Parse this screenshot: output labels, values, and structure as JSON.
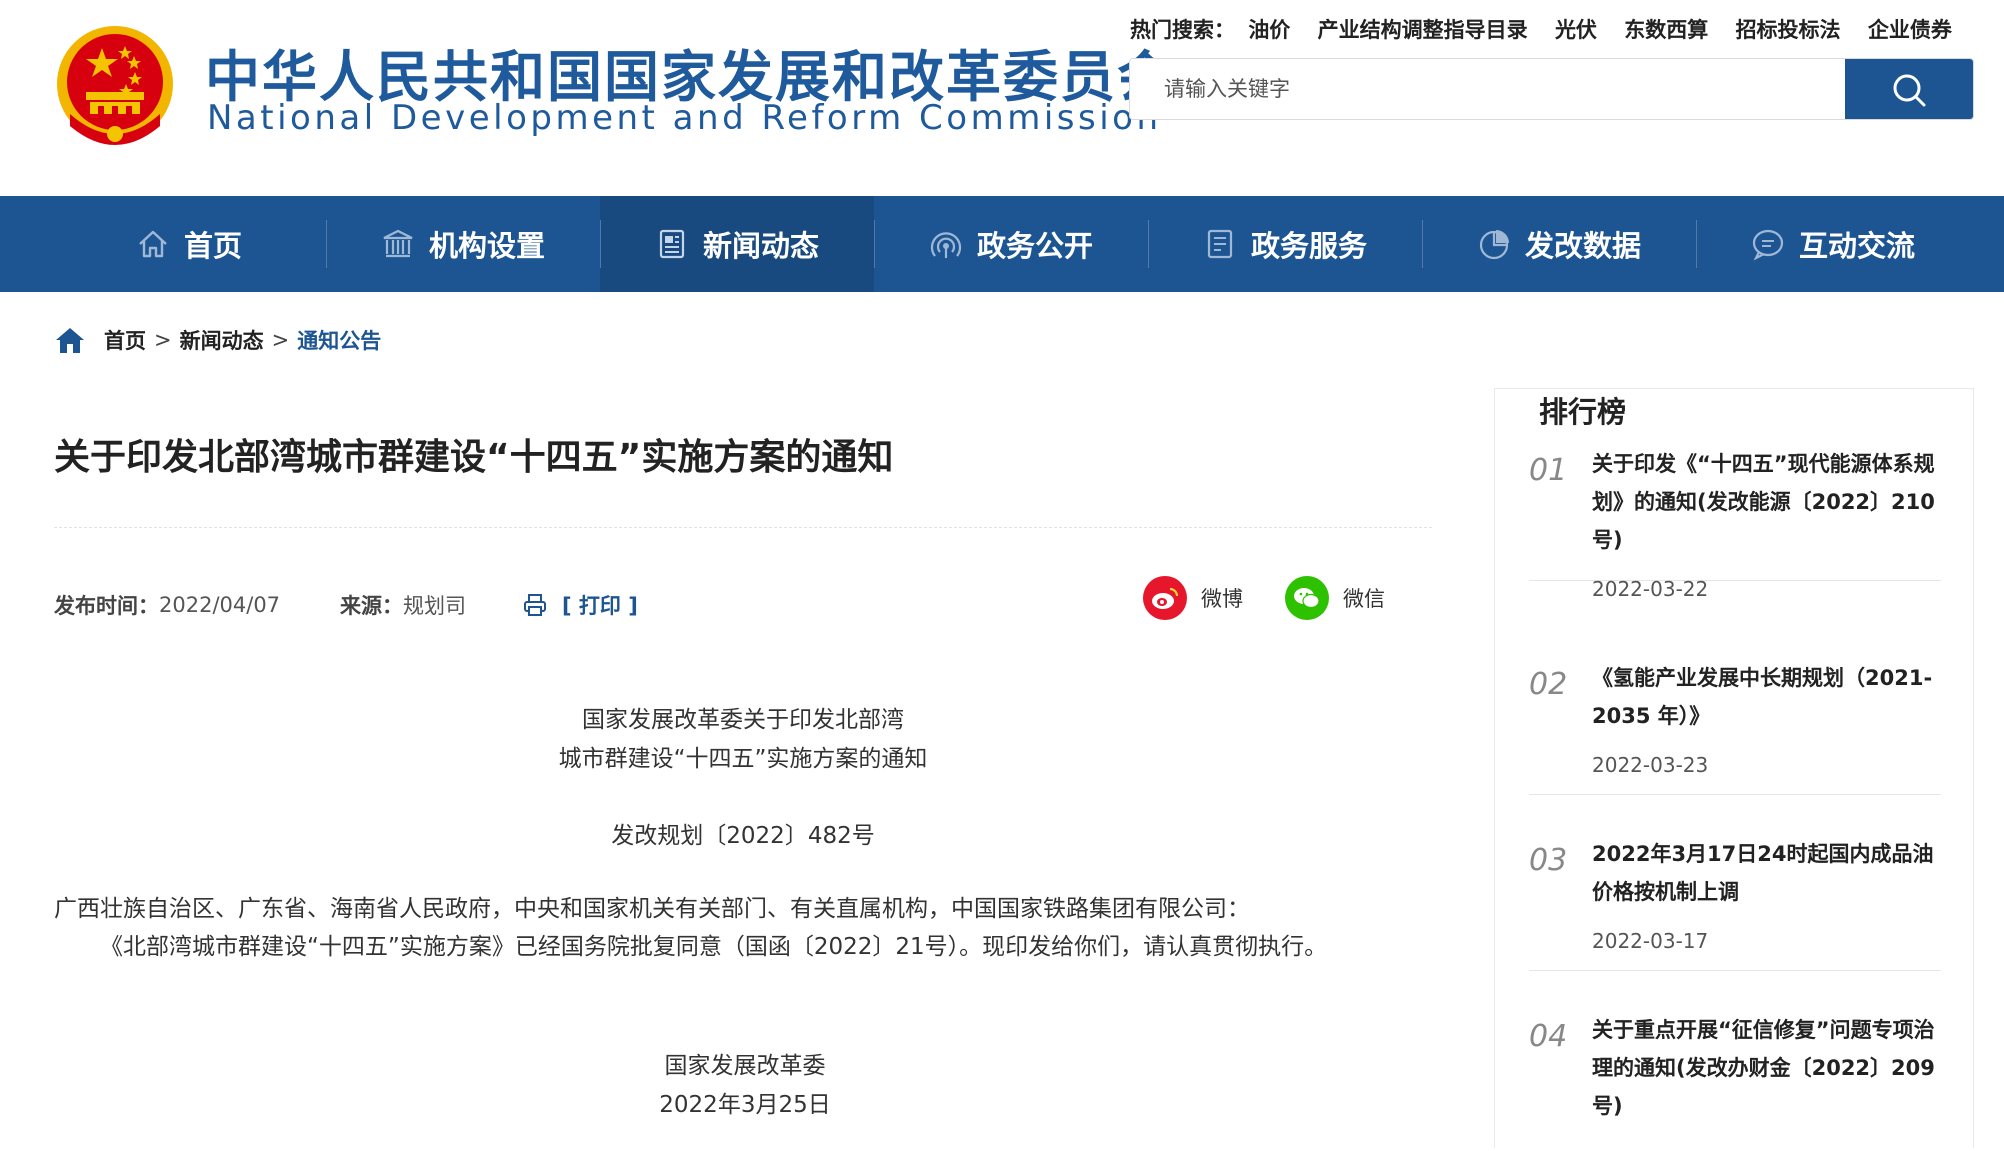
{
  "site": {
    "title_cn": "中华人民共和国国家发展和改革委员会",
    "title_en": "National Development and Reform Commission"
  },
  "hot_search": {
    "label": "热门搜索：",
    "terms": [
      "油价",
      "产业结构调整指导目录",
      "光伏",
      "东数西算",
      "招标投标法",
      "企业债券"
    ]
  },
  "search": {
    "placeholder": "请输入关键字"
  },
  "nav": {
    "items": [
      {
        "label": "首页",
        "icon": "home-icon"
      },
      {
        "label": "机构设置",
        "icon": "building-icon"
      },
      {
        "label": "新闻动态",
        "icon": "newspaper-icon"
      },
      {
        "label": "政务公开",
        "icon": "broadcast-icon"
      },
      {
        "label": "政务服务",
        "icon": "document-icon"
      },
      {
        "label": "发改数据",
        "icon": "pie-chart-icon"
      },
      {
        "label": "互动交流",
        "icon": "chat-icon"
      }
    ],
    "active_index": 2
  },
  "breadcrumb": {
    "items": [
      "首页",
      "新闻动态",
      "通知公告"
    ],
    "separator": ">"
  },
  "article": {
    "title": "关于印发北部湾城市群建设“十四五”实施方案的通知",
    "publish_label": "发布时间：",
    "publish_date": "2022/04/07",
    "source_label": "来源：",
    "source": "规划司",
    "print_label": "[ 打印 ]",
    "share_weibo": "微博",
    "share_wechat": "微信",
    "heading_line1": "国家发展改革委关于印发北部湾",
    "heading_line2": "城市群建设“十四五”实施方案的通知",
    "doc_number": "发改规划〔2022〕482号",
    "addressees": "广西壮族自治区、广东省、海南省人民政府，中央和国家机关有关部门、有关直属机构，中国国家铁路集团有限公司：",
    "body": "《北部湾城市群建设“十四五”实施方案》已经国务院批复同意（国函〔2022〕21号）。现印发给你们，请认真贯彻执行。",
    "signature": "国家发展改革委",
    "sign_date": "2022年3月25日"
  },
  "ranking": {
    "title": "排行榜",
    "items": [
      {
        "num": "01",
        "text": "关于印发《“十四五”现代能源体系规划》的通知(发改能源〔2022〕210号)",
        "date": "2022-03-22"
      },
      {
        "num": "02",
        "text": "《氢能产业发展中长期规划（2021-2035 年）》",
        "date": "2022-03-23"
      },
      {
        "num": "03",
        "text": "2022年3月17日24时起国内成品油价格按机制上调",
        "date": "2022-03-17"
      },
      {
        "num": "04",
        "text": "关于重点开展“征信修复”问题专项治理的通知(发改办财金〔2022〕209号)",
        "date": ""
      }
    ]
  },
  "colors": {
    "primary": "#1d5592",
    "nav_active": "#18497f",
    "weibo": "#e6162d",
    "wechat": "#2dc100",
    "emblem_red": "#d7000f",
    "emblem_gold": "#f5c400"
  }
}
